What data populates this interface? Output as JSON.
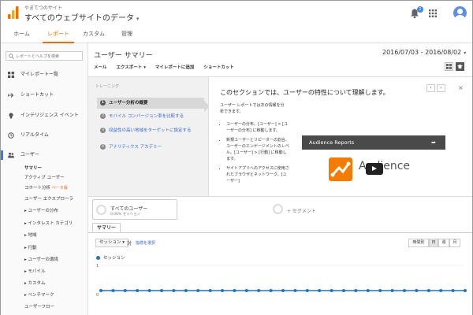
{
  "header": {
    "site_name": "やまてつのサイト",
    "view_name": "すべてのウェブサイトのデータ",
    "notification_count": "1",
    "accent_color": "#e8710a"
  },
  "nav": {
    "tabs": [
      {
        "label": "ホーム"
      },
      {
        "label": "レポート",
        "active": true
      },
      {
        "label": "カスタム"
      },
      {
        "label": "管理"
      }
    ]
  },
  "sidebar": {
    "search_placeholder": "レポートとヘルプを検索",
    "items": [
      {
        "label": "マイレポート一覧",
        "icon": "dashboard-icon"
      },
      {
        "label": "ショートカット",
        "icon": "shortcut-arrow-icon"
      },
      {
        "label": "インテリジェンス イベント",
        "icon": "lightbulb-icon"
      },
      {
        "label": "リアルタイム",
        "icon": "clock-icon"
      },
      {
        "label": "ユーザー",
        "icon": "users-icon",
        "active": true
      }
    ],
    "subitems": [
      {
        "label": "サマリー",
        "bold": true
      },
      {
        "label": "アクティブ ユーザー"
      },
      {
        "label": "コホート分析",
        "badge": "ベータ版"
      },
      {
        "label": "ユーザー エクスプローラ"
      },
      {
        "label": "▸ ユーザーの分布"
      },
      {
        "label": "▸ インタレスト カテゴリ"
      },
      {
        "label": "▸ 地域"
      },
      {
        "label": "▸ 行動"
      },
      {
        "label": "▸ ユーザーの環境"
      },
      {
        "label": "▸ モバイル"
      },
      {
        "label": "▸ カスタム"
      },
      {
        "label": "▸ ベンチマーク"
      },
      {
        "label": "ユーザーフロー"
      }
    ]
  },
  "main": {
    "title": "ユーザー サマリー",
    "date_range": "2016/07/03 - 2016/08/02",
    "toolbar": [
      "メール",
      "エクスポート ▾",
      "マイレポートに追加",
      "ショートカット"
    ]
  },
  "training": {
    "label": "トレーニング",
    "steps": [
      {
        "num": "1",
        "label": "ユーザー分析の概要"
      },
      {
        "num": "2",
        "label": "モバイル コンバージョン率を比較する"
      },
      {
        "num": "3",
        "label": "収益性の高い地域をターゲットに設定する"
      },
      {
        "num": "4",
        "label": "アナリティクス アカデミー"
      }
    ],
    "heading": "このセクションでは、ユーザーの特性について理解します。",
    "desc": "ユーザー レポートでは次の情報を分析できます。",
    "list": [
      "ユーザーの分布。[ユーザー] > [ユーザーの分布] に移動します。",
      "新規ユーザーとリピーターの割合、ユーザーのエンゲージメントのレベル。[ユーザー] > [行動] に移動します。",
      "サイトアプリへのアクセスに使用されたブラウザとネットワーク。[ユーザー]"
    ],
    "prev": "‹",
    "next": "›",
    "close": "×",
    "video_title": "Audience Reports",
    "video_logo_text": "Audience"
  },
  "segments": {
    "all_users": "すべてのユーザー",
    "all_users_sub": "0.00% セッション",
    "add_segment": "+ セグメント"
  },
  "report": {
    "tab": "サマリー",
    "metric": "セッション ▾",
    "vs": "対",
    "select_metric": "指標を選択",
    "granularity": [
      {
        "label": "時間別"
      },
      {
        "label": "日",
        "active": true
      },
      {
        "label": "週"
      },
      {
        "label": "月"
      }
    ]
  },
  "chart_data": {
    "type": "line",
    "series": [
      {
        "name": "セッション",
        "values": [
          0,
          0,
          0,
          0,
          0,
          0,
          0,
          0,
          0,
          0,
          0,
          0,
          0,
          0,
          0,
          0,
          0,
          0,
          0,
          0,
          0,
          0,
          0,
          0,
          0,
          0,
          0,
          0,
          0,
          0,
          0
        ]
      }
    ],
    "ylim": [
      0,
      1
    ],
    "ytick_labels": [
      "1",
      "0"
    ],
    "color": "#1f77b4"
  }
}
